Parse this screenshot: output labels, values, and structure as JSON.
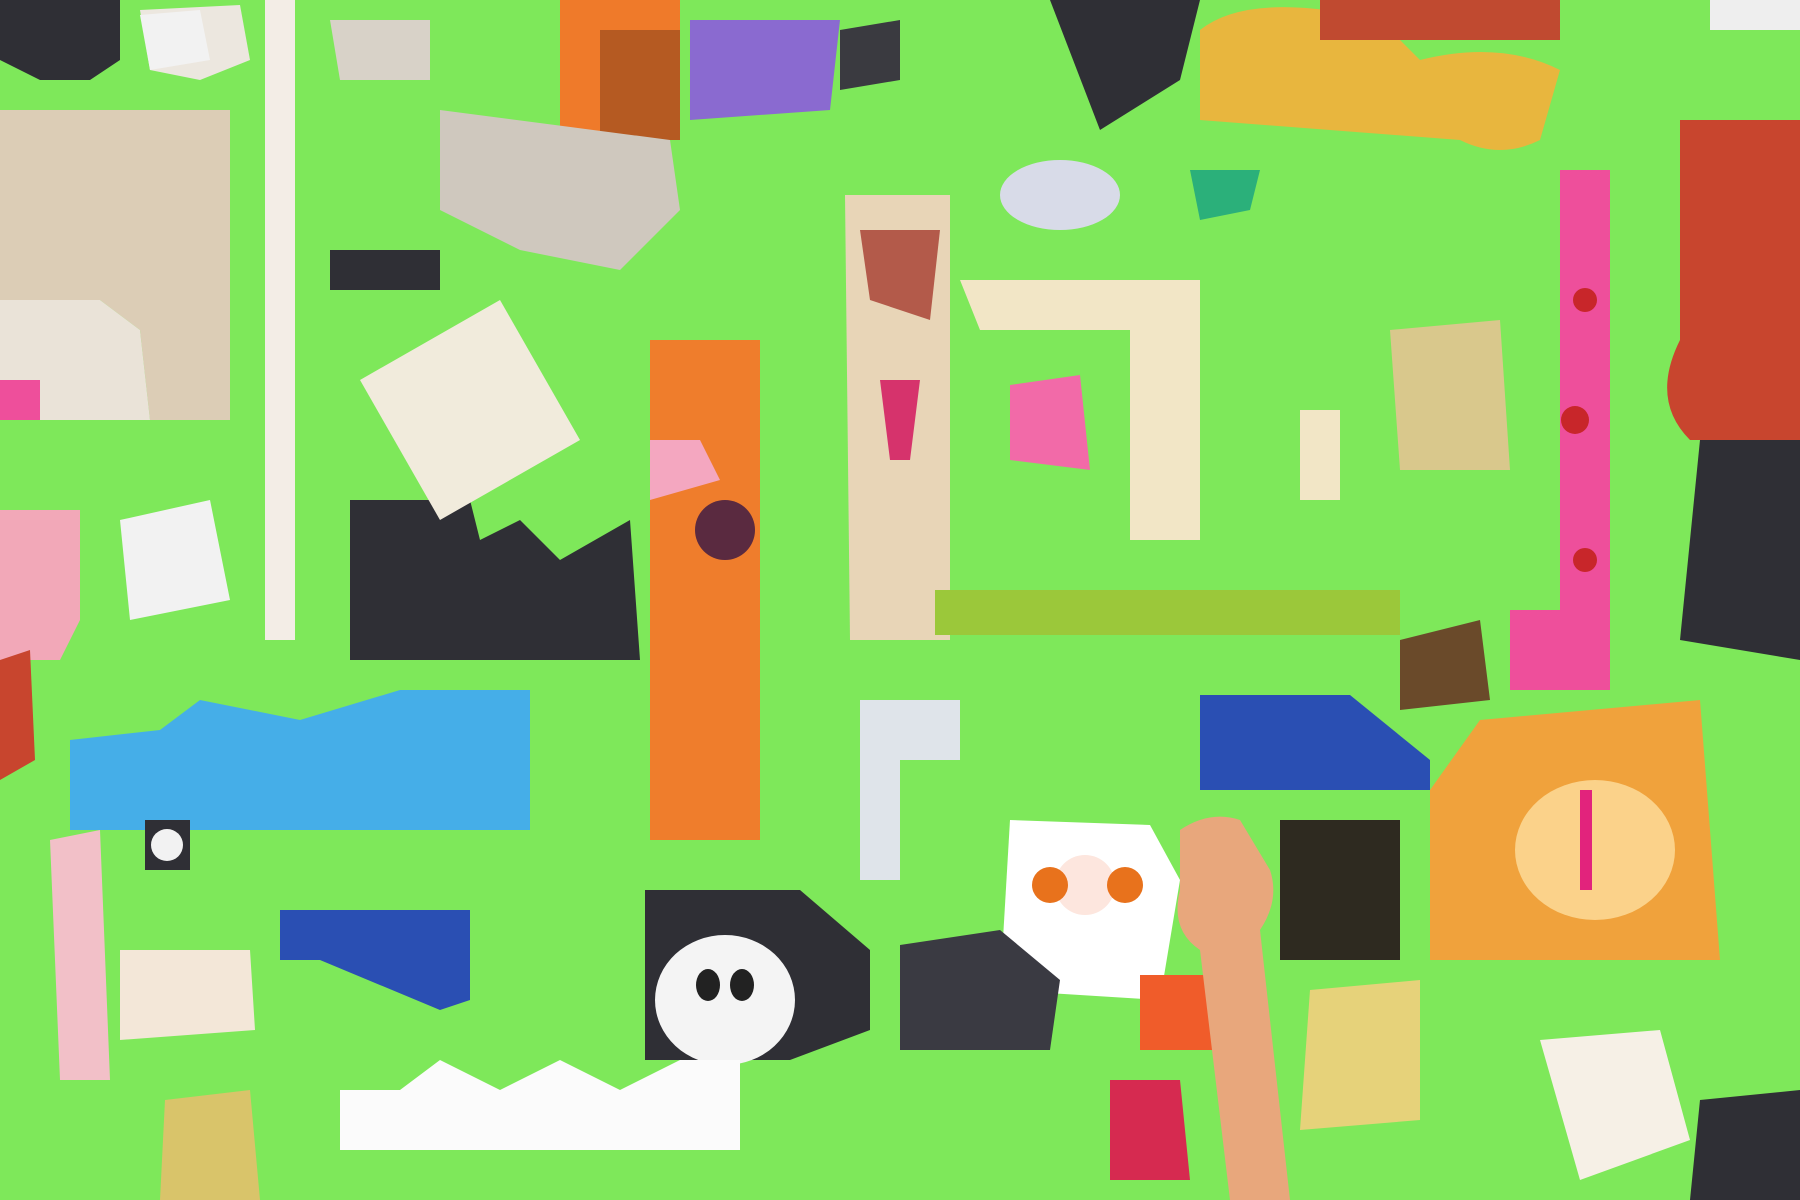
{
  "scene": {
    "kind": "photograph",
    "background_color": "#7ee85a",
    "pieces": [
      {
        "name": "elephant-piece",
        "color": "#d8c8b0"
      },
      {
        "name": "rhino-piece",
        "color": "#c9c3bb"
      },
      {
        "name": "fox-piece",
        "color": "#f07a28"
      },
      {
        "name": "kangaroo-piece",
        "color": "#ef7d2c"
      },
      {
        "name": "ostrich-piece",
        "color": "#e9c9a8"
      },
      {
        "name": "giraffe-piece",
        "color": "#ee4f9b"
      },
      {
        "name": "crocodile-piece",
        "color": "#45aee8"
      },
      {
        "name": "gorilla-piece",
        "color": "#3a3a42"
      },
      {
        "name": "panda-piece",
        "color": "#f2f2f2"
      },
      {
        "name": "sheep-piece",
        "color": "#ffffff"
      },
      {
        "name": "lion-piece",
        "color": "#f0a23c"
      },
      {
        "name": "whale-piece",
        "color": "#2a4fb3"
      },
      {
        "name": "squirrel-piece",
        "color": "#c8452e"
      },
      {
        "name": "flamingo-piece",
        "color": "#f2a8b8"
      },
      {
        "name": "snake-piece",
        "color": "#9bc83a"
      },
      {
        "name": "zebra-piece",
        "color": "#222222"
      },
      {
        "name": "pig-piece",
        "color": "#f26aa8"
      },
      {
        "name": "fish-piece",
        "color": "#8a6ad0"
      },
      {
        "name": "camel-piece",
        "color": "#e6b84a"
      },
      {
        "name": "tiger-piece",
        "color": "#e6d27a"
      },
      {
        "name": "hand",
        "color": "#e8a77c"
      }
    ]
  }
}
